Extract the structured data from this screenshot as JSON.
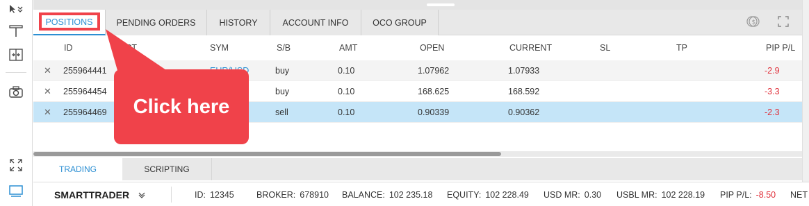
{
  "tabs": [
    {
      "label": "POSITIONS",
      "active": true
    },
    {
      "label": "PENDING ORDERS",
      "active": false
    },
    {
      "label": "HISTORY",
      "active": false
    },
    {
      "label": "ACCOUNT INFO",
      "active": false
    },
    {
      "label": "OCO GROUP",
      "active": false
    }
  ],
  "table": {
    "columns": [
      "ID",
      "ECT",
      "SYM",
      "S/B",
      "AMT",
      "OPEN",
      "CURRENT",
      "SL",
      "TP",
      "PIP P/L"
    ],
    "rows": [
      {
        "close": "✕",
        "id": "255964441",
        "sym": "EUR/USD",
        "side": "buy",
        "amt": "0.10",
        "open": "1.07962",
        "current": "1.07933",
        "sl": "",
        "tp": "",
        "pip": "-2.9"
      },
      {
        "close": "✕",
        "id": "255964454",
        "sym": "",
        "side": "buy",
        "amt": "0.10",
        "open": "168.625",
        "current": "168.592",
        "sl": "",
        "tp": "",
        "pip": "-3.3"
      },
      {
        "close": "✕",
        "id": "255964469",
        "sym": "",
        "side": "sell",
        "amt": "0.10",
        "open": "0.90339",
        "current": "0.90362",
        "sl": "",
        "tp": "",
        "pip": "-2.3"
      }
    ]
  },
  "callout": {
    "text": "Click here"
  },
  "bottom_tabs": [
    {
      "label": "TRADING",
      "active": true
    },
    {
      "label": "SCRIPTING",
      "active": false
    }
  ],
  "status": {
    "app": "SMARTTRADER",
    "id_label": "ID:",
    "id_value": "12345",
    "broker_label": "BROKER:",
    "broker_value": "678910",
    "balance_label": "BALANCE:",
    "balance_value": "102 235.18",
    "equity_label": "EQUITY:",
    "equity_value": "102 228.49",
    "usdmr_label": "USD MR:",
    "usdmr_value": "0.30",
    "usblmr_label": "USBL MR:",
    "usblmr_value": "102 228.19",
    "pippl_label": "PIP P/L:",
    "pippl_value": "-8.50",
    "net_label": "NET"
  },
  "colors": {
    "accent": "#2c8fd3",
    "negative": "#e0303a",
    "highlight": "#f0424a",
    "selected_row": "#c5e5f8"
  },
  "icons": [
    "cursor-icon",
    "horizontal-line-icon",
    "split-icon",
    "camera-icon",
    "expand-icon",
    "monitor-icon",
    "currency-icon",
    "fullscreen-icon",
    "chevron-down-icon"
  ]
}
